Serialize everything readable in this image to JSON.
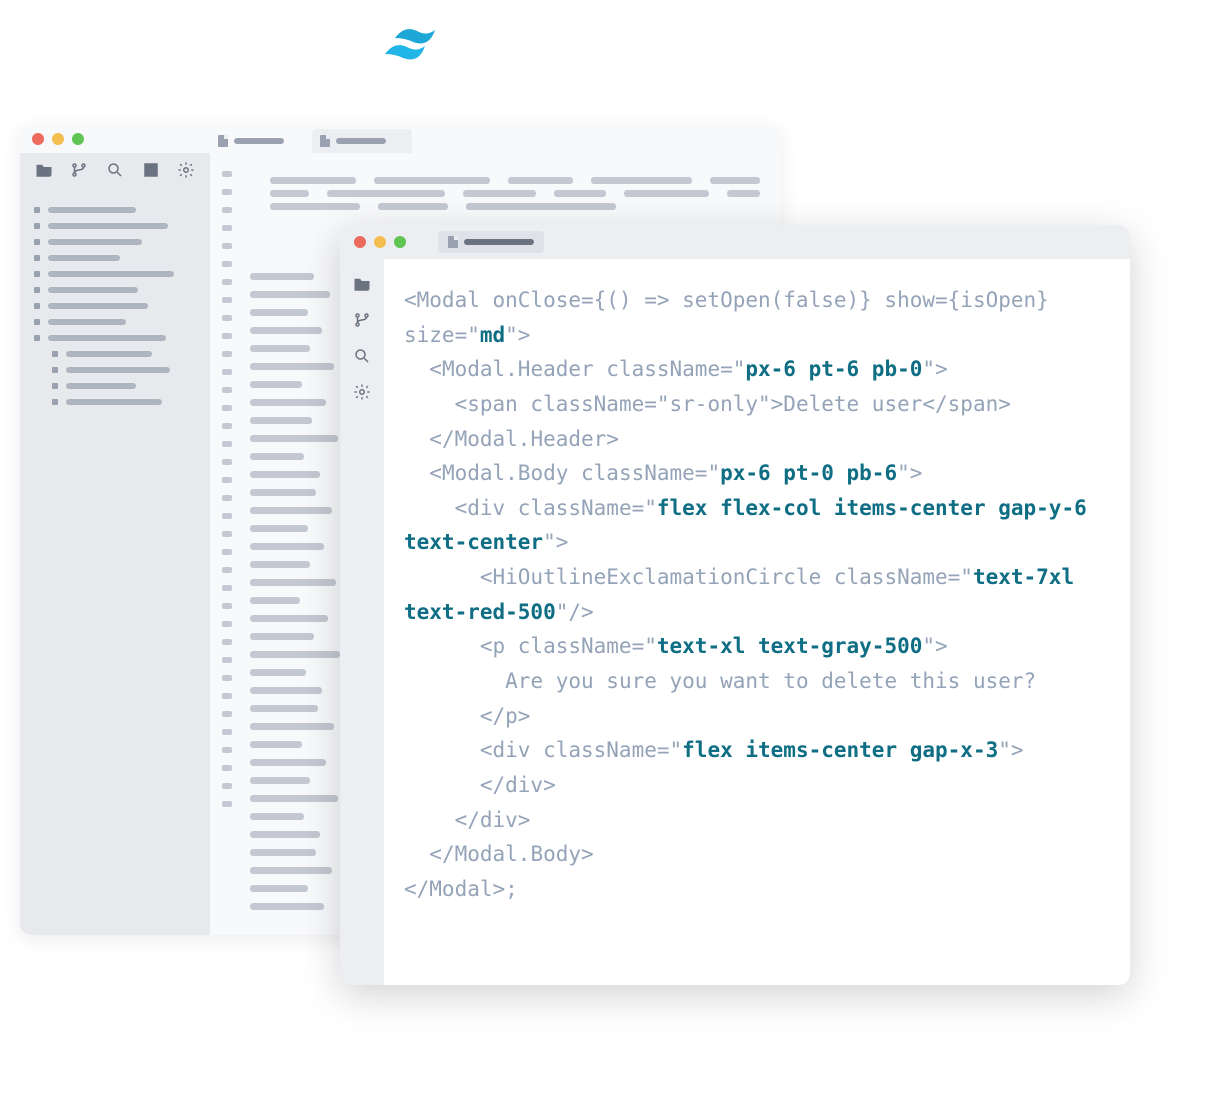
{
  "logo": {
    "name": "tailwind"
  },
  "back_window": {
    "sidebar_tree_bar_widths": [
      88,
      120,
      94,
      72,
      126,
      90,
      100,
      78,
      118,
      86,
      104,
      70,
      96
    ],
    "sidebar_tree_indents": [
      0,
      0,
      0,
      0,
      0,
      0,
      0,
      0,
      0,
      18,
      18,
      18,
      18
    ],
    "top_code_rows": [
      [
        120,
        160,
        90,
        140,
        70
      ],
      [
        60,
        180,
        110,
        80,
        130,
        50
      ],
      [
        90,
        70,
        150
      ]
    ],
    "code_line_widths": [
      64,
      80,
      58,
      72,
      60,
      84,
      52,
      76,
      62,
      88,
      54,
      70,
      66,
      82,
      58,
      74,
      60,
      86,
      50,
      78,
      64,
      90,
      56,
      72,
      68,
      84,
      52,
      76,
      60,
      88,
      54,
      70,
      66,
      82,
      58,
      74
    ]
  },
  "front_window": {
    "code": {
      "l1a": "<Modal onClose={() => setOpen(false)} show={isOpen} size=\"",
      "l1b": "md",
      "l1c": "\">",
      "l2a": "  <Modal.Header className=\"",
      "l2b": "px-6 pt-6 pb-0",
      "l2c": "\">",
      "l3": "    <span className=\"sr-only\">Delete user</span>",
      "l4": "  </Modal.Header>",
      "l5a": "  <Modal.Body className=\"",
      "l5b": "px-6 pt-0 pb-6",
      "l5c": "\">",
      "l6a": "    <div className=\"",
      "l6b": "flex flex-col items-center gap-y-6 text-center",
      "l6c": "\">",
      "l7": "      <HiOutlineExclamationCircle className=\"",
      "l7b": "text-7xl text-red-500",
      "l7c": "\"/>",
      "l8a": "      <p className=\"",
      "l8b": "text-xl text-gray-500",
      "l8c": "\">",
      "l9": "        Are you sure you want to delete this user?",
      "l10": "      </p>",
      "l11a": "      <div className=\"",
      "l11b": "flex items-center gap-x-3",
      "l11c": "\">",
      "l12": "      </div>",
      "l13": "    </div>",
      "l14": "  </Modal.Body>",
      "l15": "</Modal>;"
    }
  }
}
